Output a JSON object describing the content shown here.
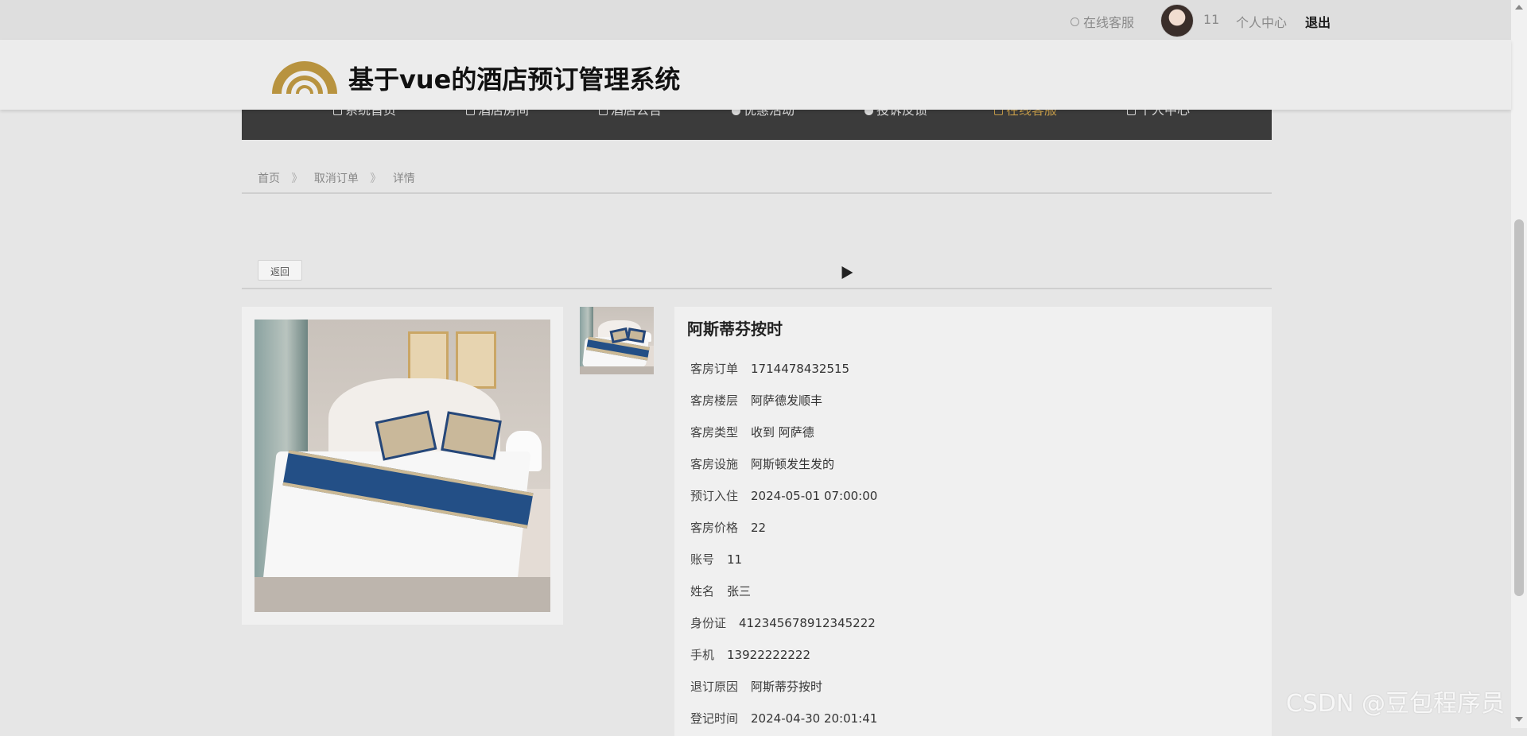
{
  "topbar": {
    "online_service": "在线客服",
    "username": "11",
    "personal_center": "个人中心",
    "logout": "退出"
  },
  "header": {
    "title": "基于vue的酒店预订管理系统",
    "logo_color": "#b8933f"
  },
  "nav": {
    "items": [
      {
        "label": "系统首页",
        "icon": "home-icon"
      },
      {
        "label": "酒店房间",
        "icon": "room-icon"
      },
      {
        "label": "酒店公告",
        "icon": "notice-icon"
      },
      {
        "label": "优惠活动",
        "icon": "promo-icon"
      },
      {
        "label": "投诉反馈",
        "icon": "feedback-icon"
      },
      {
        "label": "在线客服",
        "icon": "service-icon",
        "active": true
      },
      {
        "label": "个人中心",
        "icon": "user-icon"
      }
    ],
    "active_color": "#c29a4a"
  },
  "breadcrumb": {
    "home": "首页",
    "section": "取消订单",
    "current": "详情",
    "separator": "》"
  },
  "back_button": "返回",
  "detail": {
    "title": "阿斯蒂芬按时",
    "fields": [
      {
        "label": "客房订单",
        "value": "1714478432515"
      },
      {
        "label": "客房楼层",
        "value": "阿萨德发顺丰"
      },
      {
        "label": "客房类型",
        "value": "收到 阿萨德"
      },
      {
        "label": "客房设施",
        "value": "阿斯顿发生发的"
      },
      {
        "label": "预订入住",
        "value": "2024-05-01 07:00:00"
      },
      {
        "label": "客房价格",
        "value": "22"
      },
      {
        "label": "账号",
        "value": "11"
      },
      {
        "label": "姓名",
        "value": "张三"
      },
      {
        "label": "身份证",
        "value": "412345678912345222"
      },
      {
        "label": "手机",
        "value": "13922222222"
      },
      {
        "label": "退订原因",
        "value": "阿斯蒂芬按时"
      },
      {
        "label": "登记时间",
        "value": "2024-04-30 20:01:41"
      }
    ]
  },
  "watermark": "CSDN @豆包程序员"
}
